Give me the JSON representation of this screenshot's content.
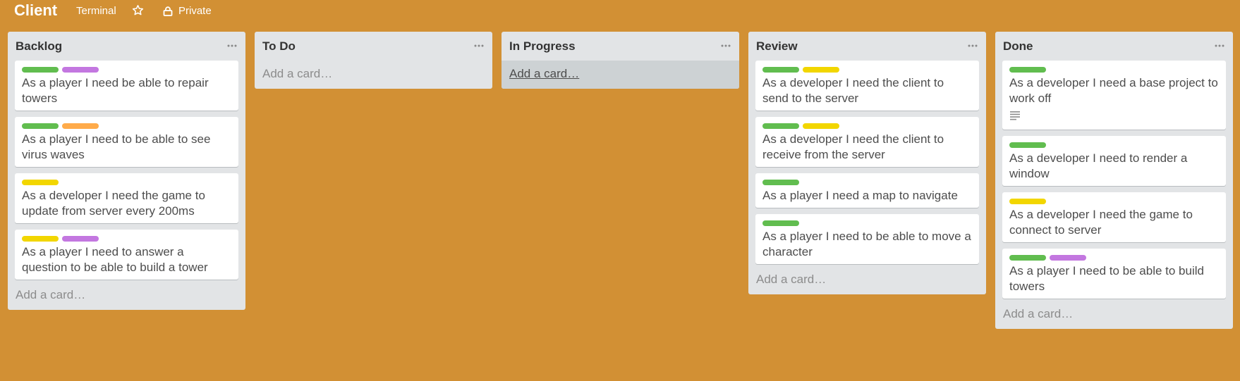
{
  "board": {
    "title": "Client",
    "team": "Terminal",
    "visibility": "Private"
  },
  "colors": {
    "background": "#d29034",
    "green": "#61bd4f",
    "purple": "#c377e0",
    "orange": "#ffab4a",
    "yellow": "#f2d600"
  },
  "lists": [
    {
      "title": "Backlog",
      "add_card": "Add a card…",
      "cards": [
        {
          "labels": [
            "green",
            "purple"
          ],
          "text": "As a player I need be able to repair towers"
        },
        {
          "labels": [
            "green",
            "orange"
          ],
          "text": "As a player I need to be able to see virus waves"
        },
        {
          "labels": [
            "yellow"
          ],
          "text": "As a developer I need the game to update from server every 200ms"
        },
        {
          "labels": [
            "yellow",
            "purple"
          ],
          "text": "As a player I need to answer a question to be able to build a tower"
        }
      ]
    },
    {
      "title": "To Do",
      "add_card": "Add a card…",
      "cards": []
    },
    {
      "title": "In Progress",
      "add_card": "Add a card…",
      "cards": []
    },
    {
      "title": "Review",
      "add_card": "Add a card…",
      "cards": [
        {
          "labels": [
            "green",
            "yellow"
          ],
          "text": "As a developer I need the client to send to the server"
        },
        {
          "labels": [
            "green",
            "yellow"
          ],
          "text": "As a developer I need the client to receive from the server"
        },
        {
          "labels": [
            "green"
          ],
          "text": "As a player I need a map to navigate"
        },
        {
          "labels": [
            "green"
          ],
          "text": "As a player I need to be able to move a character"
        }
      ]
    },
    {
      "title": "Done",
      "add_card": "Add a card…",
      "cards": [
        {
          "labels": [
            "green"
          ],
          "text": "As a developer I need a base project to work off",
          "has_description": true
        },
        {
          "labels": [
            "green"
          ],
          "text": "As a developer I need to render a window"
        },
        {
          "labels": [
            "yellow"
          ],
          "text": "As a developer I need the game to connect to server"
        },
        {
          "labels": [
            "green",
            "purple"
          ],
          "text": "As a player I need to be able to build towers"
        }
      ]
    }
  ]
}
